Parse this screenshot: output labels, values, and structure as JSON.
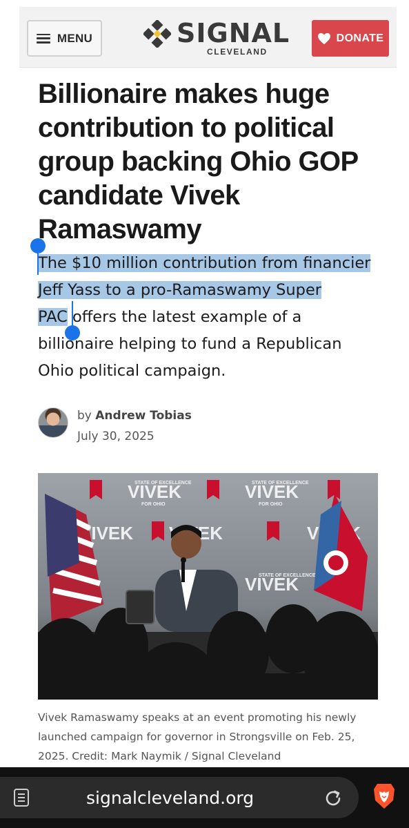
{
  "header": {
    "menu_label": "MENU",
    "logo_text": "SIGNAL",
    "logo_sub": "CLEVELAND",
    "donate_label": "DONATE"
  },
  "article": {
    "headline": "Billionaire makes huge contribution to political group backing Ohio GOP candidate Vivek Ramaswamy",
    "dek_selected_line1": "The $10 million contribution from financier",
    "dek_selected_line2": "Jeff Yass to a pro-Ramaswamy Super",
    "dek_selected_line3": "PAC",
    "dek_rest_line3": " offers the latest example of a",
    "dek_line4": "billionaire helping to fund a Republican",
    "dek_line5": "Ohio political campaign.",
    "by_prefix": "by",
    "author": "Andrew Tobias",
    "date": "July 30, 2025",
    "photo_backdrop_text": "VIVEK",
    "photo_backdrop_small": "STATE OF EXCELLENCE",
    "photo_backdrop_sub": "FOR OHIO",
    "caption": "Vivek Ramaswamy speaks at an event promoting his newly launched campaign for governor in Strongsville on Feb. 25, 2025. Credit: Mark Naymik / Signal Cleveland"
  },
  "browser": {
    "url": "signalcleveland.org",
    "icons": [
      "reader-mode-icon",
      "reload-icon",
      "brave-lion-icon"
    ]
  },
  "colors": {
    "donate": "#d9464b",
    "logo_accent": "#f1c232",
    "selection": "#a7c7e7",
    "selection_handle": "#1a73e8",
    "browser_bar": "#111111"
  }
}
